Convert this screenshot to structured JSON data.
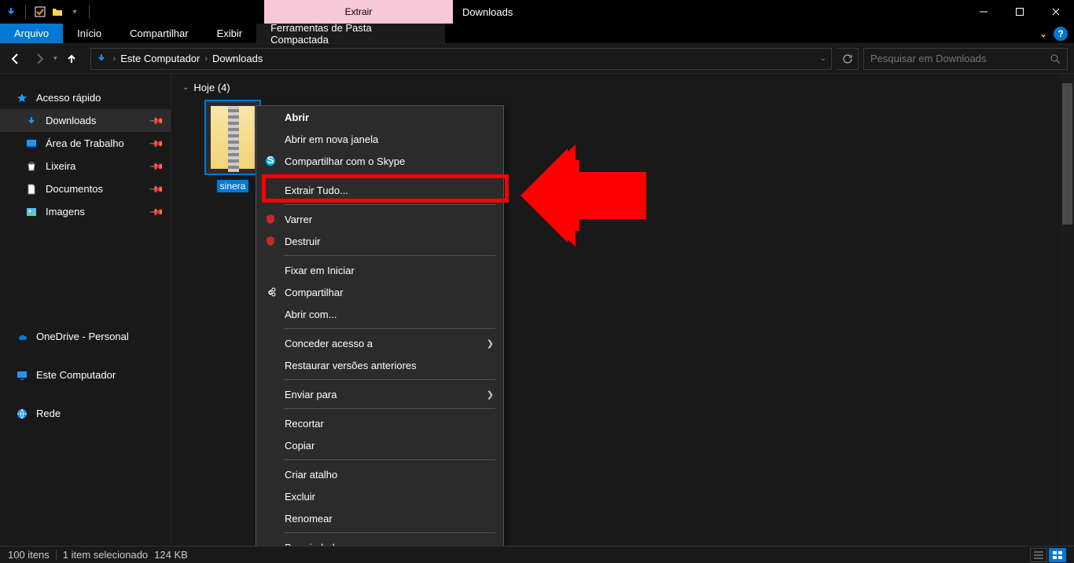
{
  "titlebar": {
    "extract_tab": "Extrair",
    "title": "Downloads"
  },
  "ribbon": {
    "file": "Arquivo",
    "home": "Início",
    "share": "Compartilhar",
    "view": "Exibir",
    "tools": "Ferramentas de Pasta Compactada"
  },
  "nav": {
    "crumb_pc": "Este Computador",
    "crumb_downloads": "Downloads",
    "search_placeholder": "Pesquisar em Downloads"
  },
  "sidebar": {
    "quick": "Acesso rápido",
    "downloads": "Downloads",
    "desktop": "Área de Trabalho",
    "recycle": "Lixeira",
    "documents": "Documentos",
    "pictures": "Imagens",
    "onedrive": "OneDrive - Personal",
    "pc": "Este Computador",
    "network": "Rede"
  },
  "content": {
    "group_today": "Hoje (4)",
    "file_name": "sinera"
  },
  "context_menu": {
    "open": "Abrir",
    "open_new": "Abrir em nova janela",
    "skype": "Compartilhar com o Skype",
    "extract_all": "Extrair Tudo...",
    "scan": "Varrer",
    "shred": "Destruir",
    "pin_start": "Fixar em Iniciar",
    "share": "Compartilhar",
    "open_with": "Abrir com...",
    "grant_access": "Conceder acesso a",
    "restore": "Restaurar versões anteriores",
    "send_to": "Enviar para",
    "cut": "Recortar",
    "copy": "Copiar",
    "shortcut": "Criar atalho",
    "delete": "Excluir",
    "rename": "Renomear",
    "properties": "Propriedades"
  },
  "status": {
    "count": "100 itens",
    "selected": "1 item selecionado",
    "size": "124 KB"
  },
  "icons": {
    "down_arrow": "↓",
    "check": "✓",
    "folder": "📁"
  }
}
